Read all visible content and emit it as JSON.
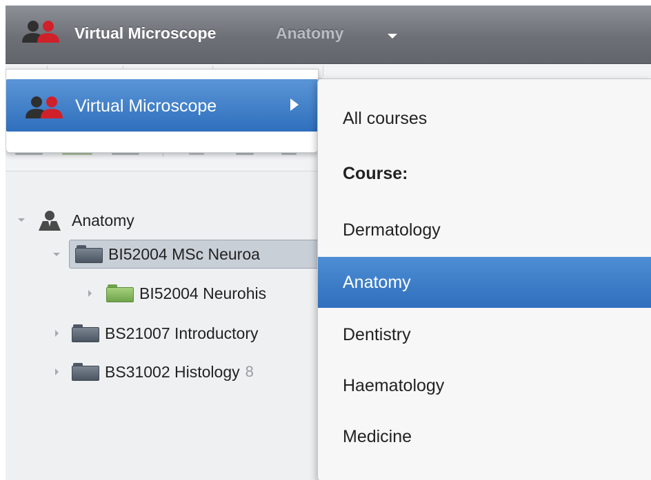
{
  "header": {
    "app_name": "Virtual Microscope",
    "course": "Anatomy",
    "icon": "users-icon"
  },
  "tree": {
    "root_label": "Anatomy",
    "items": [
      {
        "label": "BI52004 MSc Neuroa",
        "expanded": true,
        "selected": true,
        "folder_color": "gray"
      },
      {
        "label": "BI52004 Neurohis",
        "expanded": false,
        "selected": false,
        "folder_color": "green"
      },
      {
        "label": "BS21007 Introductory",
        "expanded": false,
        "selected": false,
        "folder_color": "gray"
      },
      {
        "label": "BS31002 Histology",
        "expanded": false,
        "selected": false,
        "folder_color": "gray",
        "badge": "8"
      }
    ]
  },
  "menu": {
    "label": "Virtual Microscope",
    "submenu": {
      "items": [
        {
          "label": "All courses",
          "type": "item"
        },
        {
          "label": "Course:",
          "type": "heading"
        },
        {
          "label": "Dermatology",
          "type": "item"
        },
        {
          "label": "Anatomy",
          "type": "item",
          "active": true
        },
        {
          "label": "Dentistry",
          "type": "item"
        },
        {
          "label": "Haematology",
          "type": "item"
        },
        {
          "label": "Medicine",
          "type": "item"
        }
      ]
    }
  },
  "colors": {
    "accent": "#2f6fbd",
    "header_bg": "#6d7077",
    "user_red": "#d0212a",
    "user_dark": "#2f2f2f"
  }
}
